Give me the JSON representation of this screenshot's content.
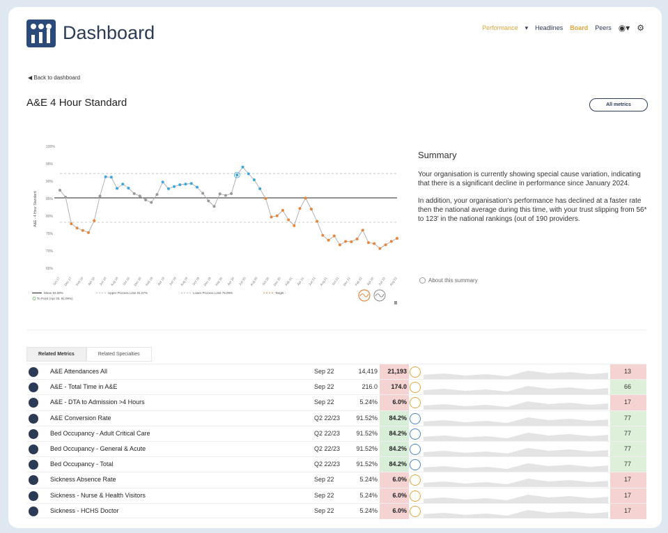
{
  "brand": {
    "title": "Dashboard",
    "logo_icon": "people-chart-logo"
  },
  "nav": {
    "performance": "Performance",
    "performance_caret": "▾",
    "headlines": "Headlines",
    "board": "Board",
    "peers": "Peers",
    "account_icon": "user-icon",
    "settings_icon": "settings-icon"
  },
  "back_link": "Back to dashboard",
  "page_title": "A&E 4 Hour Standard",
  "all_metrics_label": "All metrics",
  "chart_data": {
    "type": "line",
    "ylabel": "A&E - 4 Hour Standard",
    "ylim": [
      60,
      100
    ],
    "y_ticks": [
      "100%",
      "95%",
      "90%",
      "85%",
      "80%",
      "75%",
      "70%",
      "65%"
    ],
    "x": [
      "Oct 17",
      "Dec 17",
      "Feb 18",
      "Apr 18",
      "Jun 18",
      "Aug 18",
      "Oct 18",
      "Dec 18",
      "Feb 19",
      "Apr 19",
      "Jun 19",
      "Aug 19",
      "Oct 19",
      "Dec 19",
      "Feb 20",
      "Apr 20",
      "Jun 20",
      "Aug 20",
      "Oct 20",
      "Dec 20",
      "Feb 21",
      "Apr 21",
      "Jun 21",
      "Aug 21",
      "Oct 21",
      "Dec 21",
      "Feb 22",
      "Apr 22",
      "Jun 22",
      "Aug 22"
    ],
    "values": [
      85.6,
      83.3,
      74.6,
      73.2,
      72.4,
      71.7,
      75.6,
      83.7,
      90.0,
      89.9,
      86.2,
      87.6,
      86.3,
      84.5,
      83.7,
      82.4,
      81.6,
      84.2,
      88.3,
      86.1,
      86.8,
      87.4,
      87.6,
      87.8,
      86.6,
      84.6,
      82.1,
      80.3,
      84.4,
      83.9,
      84.5,
      90.6,
      93.2,
      91.0,
      89.0,
      86.1,
      82.9,
      76.8,
      77.2,
      79.0,
      75.9,
      74.0,
      79.6,
      83.0,
      79.4,
      75.4,
      70.8,
      69.2,
      70.6,
      67.7,
      68.8,
      68.7,
      69.6,
      72.5,
      68.4,
      68.1,
      66.5,
      67.7,
      68.8,
      69.8
    ],
    "mean": 83.08,
    "upper_process_limit": 91.07,
    "lower_process_limit": 75.09,
    "legend": [
      "Mean 83.08%",
      "Upper Process Limit 91.07%",
      "Lower Process Limit 75.09%",
      "Target -"
    ],
    "focus_point_label": "To Point (Apr 20, 91.09%)",
    "colors": {
      "improving": "#3aa7e0",
      "concern": "#e8853a",
      "common": "#999999",
      "mean": "#222222",
      "limits": "#bbbbbb"
    }
  },
  "summary": {
    "heading": "Summary",
    "p1": "Your organisation is currently showing special cause variation, indicating that there is a significant decline in performance since January 2024.",
    "p2": "In addition, your organisation's performance has declined at a faster rate then the national average during this time, with your trust slipping from 56* to 123' in the national rankings (out of 190 providers.",
    "about": "About this summary"
  },
  "tabs": [
    "Related Metrics",
    "Related Specialties"
  ],
  "metrics": [
    {
      "name": "A&E Attendances All",
      "period": "Sep 22",
      "prev": "14,419",
      "current": "21,193",
      "status": "concern",
      "rank": "13"
    },
    {
      "name": "A&E - Total Time in A&E",
      "period": "Sep 22",
      "prev": "216.0",
      "current": "174.0",
      "status": "concern",
      "rank": "66"
    },
    {
      "name": "A&E - DTA to Admission >4 Hours",
      "period": "Sep 22",
      "prev": "5.24%",
      "current": "6.0%",
      "status": "concern",
      "rank": "17"
    },
    {
      "name": "A&E Conversion Rate",
      "period": "Q2 22/23",
      "prev": "91.52%",
      "current": "84.2%",
      "status": "improving",
      "rank": "77"
    },
    {
      "name": "Bed Occupancy - Adult Critical Care",
      "period": "Q2 22/23",
      "prev": "91.52%",
      "current": "84.2%",
      "status": "improving",
      "rank": "77"
    },
    {
      "name": "Bed Occupancy - General & Acute",
      "period": "Q2 22/23",
      "prev": "91.52%",
      "current": "84.2%",
      "status": "improving",
      "rank": "77"
    },
    {
      "name": "Bed Occupancy - Total",
      "period": "Q2 22/23",
      "prev": "91.52%",
      "current": "84.2%",
      "status": "improving",
      "rank": "77"
    },
    {
      "name": "Sickness Absence Rate",
      "period": "Sep 22",
      "prev": "5.24%",
      "current": "6.0%",
      "status": "concern",
      "rank": "17"
    },
    {
      "name": "Sickness - Nurse & Health Visitors",
      "period": "Sep 22",
      "prev": "5.24%",
      "current": "6.0%",
      "status": "concern",
      "rank": "17"
    },
    {
      "name": "Sickness - HCHS Doctor",
      "period": "Sep 22",
      "prev": "5.24%",
      "current": "6.0%",
      "status": "concern",
      "rank": "17"
    }
  ],
  "status_colors": {
    "concern": {
      "cell": "#f6d3d3",
      "circle": "#e8a33a",
      "rank": "#f6d3d3"
    },
    "improving": {
      "cell": "#d8eed8",
      "circle": "#4a86c8",
      "rank": "#dff0da"
    },
    "rank_good": "#dff0da"
  }
}
